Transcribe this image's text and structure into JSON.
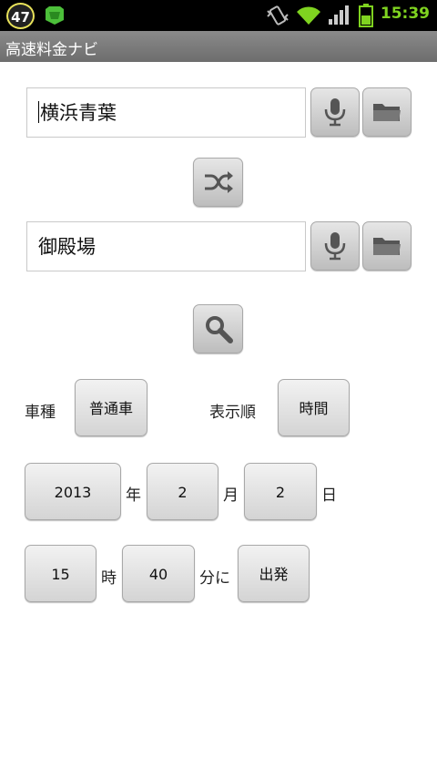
{
  "statusbar": {
    "badge": "47",
    "time": "15:39",
    "icons": [
      "notification-app-icon",
      "vibrate-icon",
      "wifi-icon",
      "signal-icon",
      "battery-icon"
    ]
  },
  "app": {
    "title": "高速料金ナビ"
  },
  "route": {
    "origin": "横浜青葉",
    "destination": "御殿場"
  },
  "options": {
    "vehicle_label": "車種",
    "vehicle_value": "普通車",
    "order_label": "表示順",
    "order_value": "時間"
  },
  "date": {
    "year": "2013",
    "year_unit": "年",
    "month": "2",
    "month_unit": "月",
    "day": "2",
    "day_unit": "日"
  },
  "time": {
    "hour": "15",
    "hour_unit": "時",
    "minute": "40",
    "minute_unit": "分に",
    "mode": "出発"
  },
  "colors": {
    "clock": "#7fd320",
    "titlebar": "#7a7a7a"
  }
}
